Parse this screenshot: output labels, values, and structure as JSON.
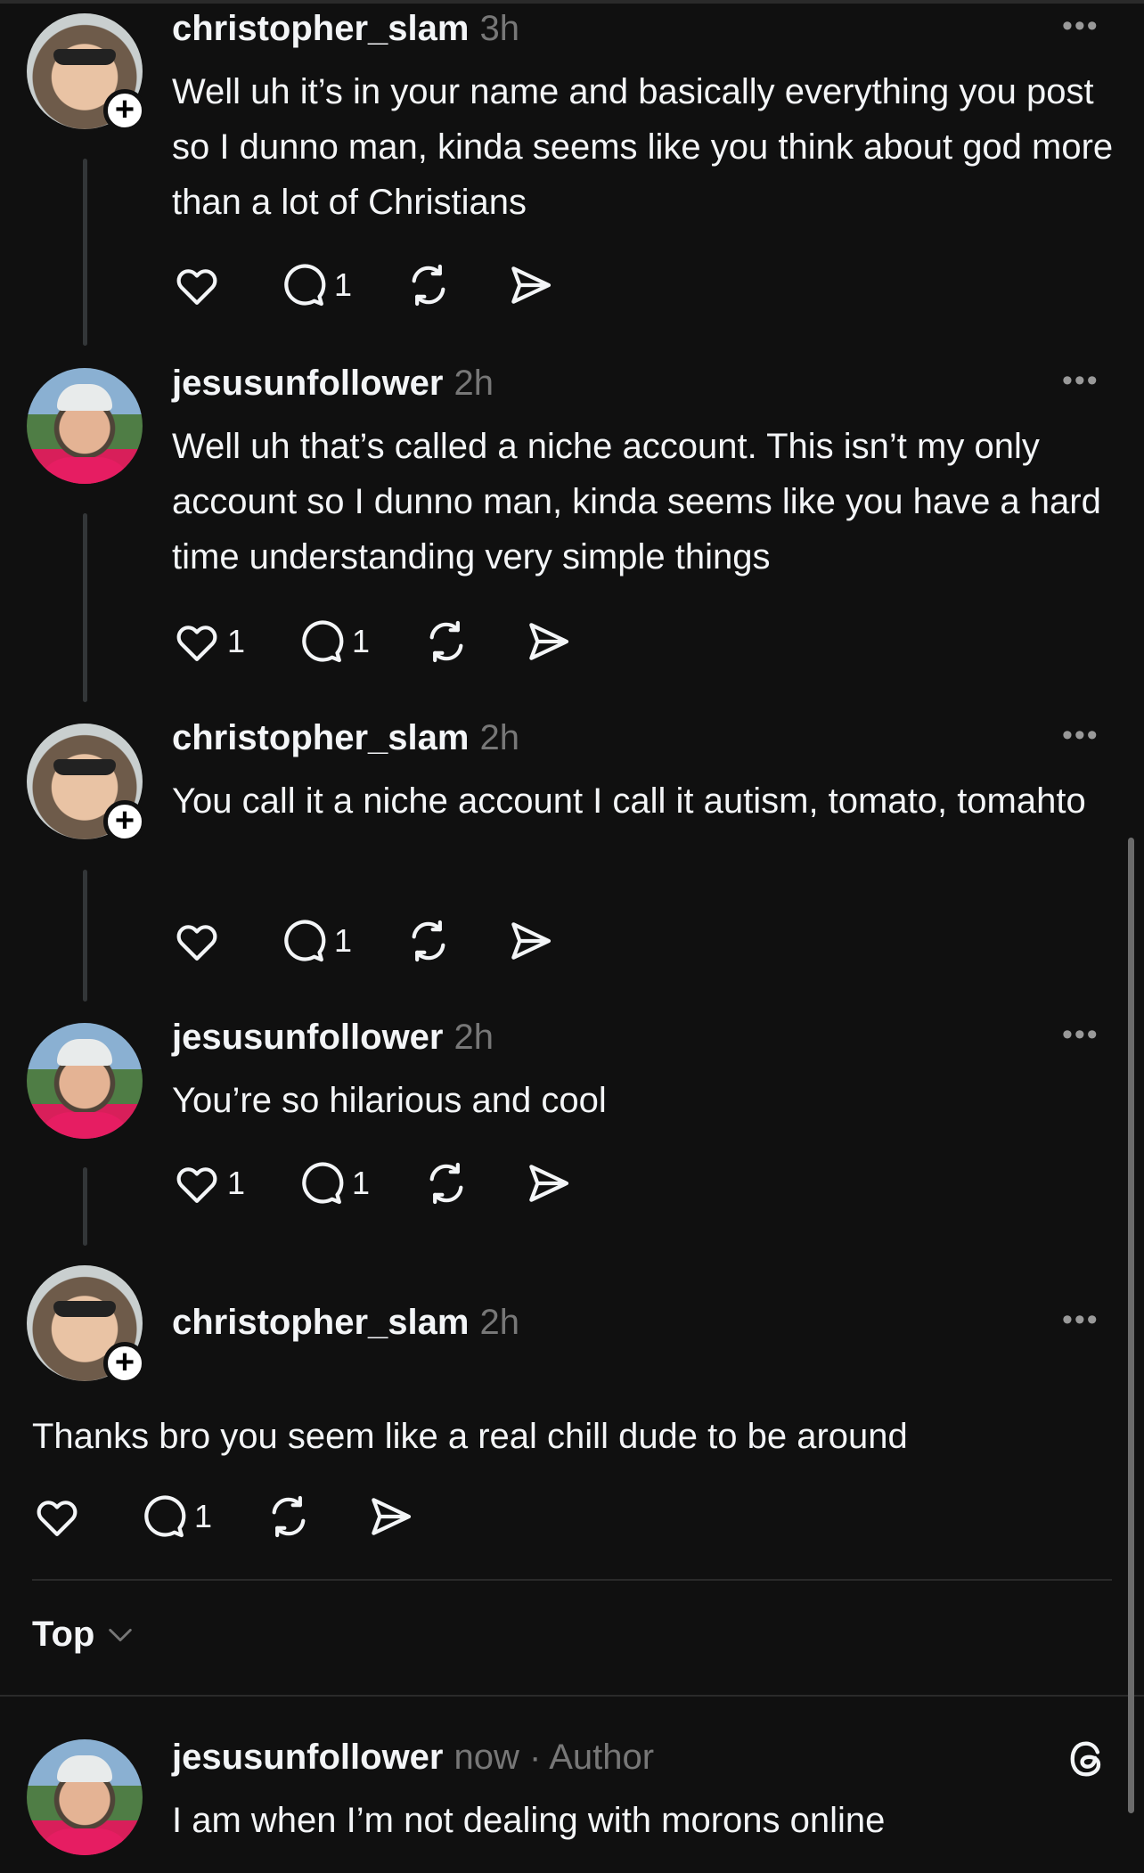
{
  "posts": [
    {
      "username": "christopher_slam",
      "time": "3h",
      "text": "Well uh it’s in your name and basically everything you post so I dunno man, kinda seems like you think about god more than a lot of Christians",
      "likes": "",
      "replies": "1"
    },
    {
      "username": "jesusunfollower",
      "time": "2h",
      "text": "Well uh that’s called a niche account. This isn’t my only account so I dunno man, kinda seems like you have a hard time understanding very simple things",
      "likes": "1",
      "replies": "1"
    },
    {
      "username": "christopher_slam",
      "time": "2h",
      "text": "You call it a niche account I call it autism, tomato, tomahto",
      "likes": "",
      "replies": "1"
    },
    {
      "username": "jesusunfollower",
      "time": "2h",
      "text": "You’re so hilarious and cool",
      "likes": "1",
      "replies": "1"
    },
    {
      "username": "christopher_slam",
      "time": "2h",
      "text": "Thanks bro you seem like a real chill dude to be around",
      "likes": "",
      "replies": "1"
    }
  ],
  "sort": {
    "label": "Top"
  },
  "reply": {
    "username": "jesusunfollower",
    "time": "now",
    "author_tag": " · Author",
    "text": "I am when I’m not dealing with morons online"
  },
  "more_label": "•••",
  "follow_label": "+",
  "colors": {
    "background": "#101010",
    "text": "#f3f5f7",
    "muted": "#777777",
    "follow_badge": "#ffffff"
  }
}
